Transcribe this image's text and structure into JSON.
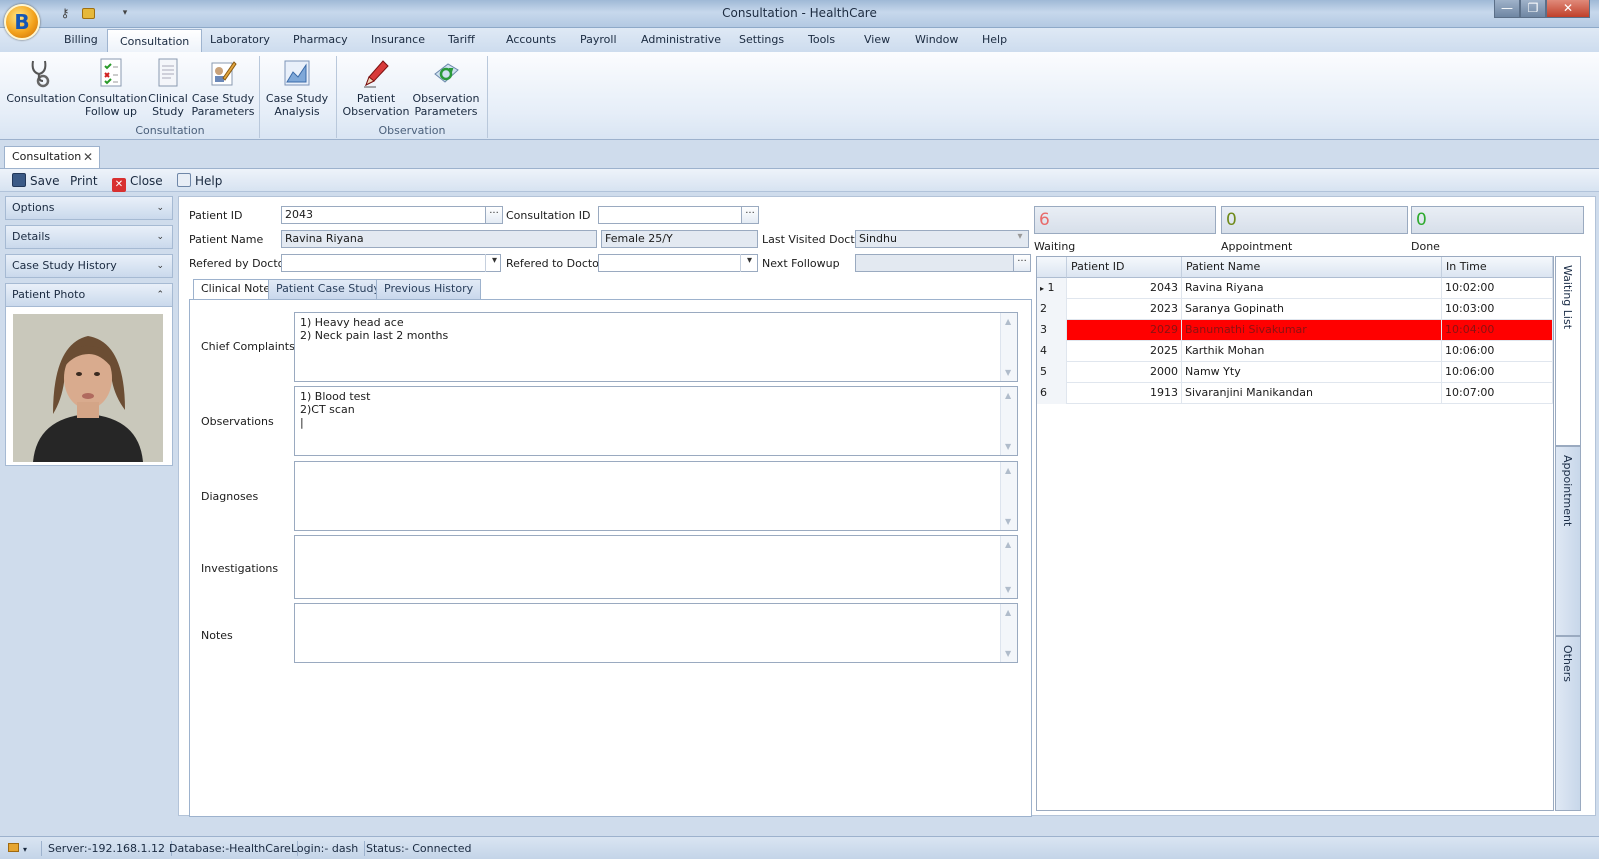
{
  "window": {
    "title": "Consultation - HealthCare",
    "logo_letter": "B",
    "controls": {
      "minimize": "—",
      "maximize": "❐",
      "close": "✕"
    }
  },
  "menu": [
    "Billing",
    "Consultation",
    "Laboratory",
    "Pharmacy",
    "Insurance",
    "Tariff",
    "Accounts",
    "Payroll",
    "Administrative",
    "Settings",
    "Tools",
    "View",
    "Window",
    "Help"
  ],
  "menu_active_index": 1,
  "ribbon": {
    "groups": [
      {
        "label": "Consultation",
        "buttons": [
          {
            "line1": "Consultation",
            "line2": "",
            "icon": "stethoscope-icon"
          },
          {
            "line1": "Consultation",
            "line2": "Follow up",
            "icon": "checklist-icon"
          },
          {
            "line1": "Clinical",
            "line2": "Study",
            "icon": "document-icon"
          },
          {
            "line1": "Case Study",
            "line2": "Parameters",
            "icon": "edit-document-icon"
          },
          {
            "line1": "Case Study",
            "line2": "Analysis",
            "icon": "chart-icon"
          }
        ]
      },
      {
        "label": "Observation",
        "buttons": [
          {
            "line1": "Patient",
            "line2": "Observation",
            "icon": "pen-icon"
          },
          {
            "line1": "Observation",
            "line2": "Parameters",
            "icon": "recycle-icon"
          }
        ]
      }
    ]
  },
  "doc_tab": {
    "label": "Consultation",
    "close": "✕"
  },
  "toolbar": {
    "save": "Save",
    "print": "Print",
    "close": "Close",
    "help": "Help"
  },
  "left_panel": {
    "sections": [
      {
        "label": "Options",
        "chevron": "⌄"
      },
      {
        "label": "Details",
        "chevron": "⌄"
      },
      {
        "label": "Case Study History",
        "chevron": "⌄"
      },
      {
        "label": "Patient Photo",
        "chevron": "⌃"
      }
    ]
  },
  "form": {
    "patient_id_label": "Patient ID",
    "patient_id": "2043",
    "consultation_id_label": "Consultation ID",
    "consultation_id": "",
    "patient_name_label": "Patient Name",
    "patient_name": "Ravina Riyana",
    "gender_age": "Female 25/Y",
    "last_visited_doctor_label": "Last Visited Doctor",
    "last_visited_doctor": "Sindhu",
    "referred_by_label": "Refered by Doctor",
    "referred_by": "",
    "referred_to_label": "Refered to Doctor",
    "referred_to": "",
    "next_followup_label": "Next Followup",
    "next_followup": "",
    "ellipsis": "···",
    "dropdown_arrow": "▾"
  },
  "tabs": [
    "Clinical Note",
    "Patient Case Study",
    "Previous History"
  ],
  "tab_active_index": 0,
  "clinical_note": {
    "chief_complaints_label": "Chief Complaints",
    "chief_complaints": "1) Heavy head ace\n2) Neck pain last 2 months",
    "observations_label": "Observations",
    "observations": "1) Blood test\n2)CT scan\n|",
    "diagnoses_label": "Diagnoses",
    "diagnoses": "",
    "investigations_label": "Investigations",
    "investigations": "",
    "notes_label": "Notes",
    "notes": ""
  },
  "counters": {
    "waiting": {
      "value": "6",
      "label": "Waiting",
      "color": "#e86a6a"
    },
    "appointment": {
      "value": "0",
      "label": "Appointment",
      "color": "#6f8a1a"
    },
    "done": {
      "value": "0",
      "label": "Done",
      "color": "#2eaa2e"
    }
  },
  "grid": {
    "headers": [
      "",
      "Patient ID",
      "Patient Name",
      "In Time"
    ],
    "rows": [
      {
        "num": "1",
        "marker": "▸",
        "id": "2043",
        "name": "Ravina Riyana",
        "time": "10:02:00"
      },
      {
        "num": "2",
        "marker": "",
        "id": "2023",
        "name": "Saranya Gopinath",
        "time": "10:03:00"
      },
      {
        "num": "3",
        "marker": "",
        "id": "2029",
        "name": "Banumathi Sivakumar",
        "time": "10:04:00"
      },
      {
        "num": "4",
        "marker": "",
        "id": "2025",
        "name": "Karthik Mohan",
        "time": "10:06:00"
      },
      {
        "num": "5",
        "marker": "",
        "id": "2000",
        "name": "Namw Yty",
        "time": "10:06:00"
      },
      {
        "num": "6",
        "marker": "",
        "id": "1913",
        "name": "Sivaranjini Manikandan",
        "time": "10:07:00"
      }
    ],
    "highlight_row_index": 2,
    "highlight_color": "#ff0000"
  },
  "side_tabs": [
    "Waiting List",
    "Appointment",
    "Others"
  ],
  "status": {
    "server": "Server:-192.168.1.12",
    "database": "Database:-HealthCare",
    "login": "Login:- dash",
    "state": "Status:- Connected"
  }
}
